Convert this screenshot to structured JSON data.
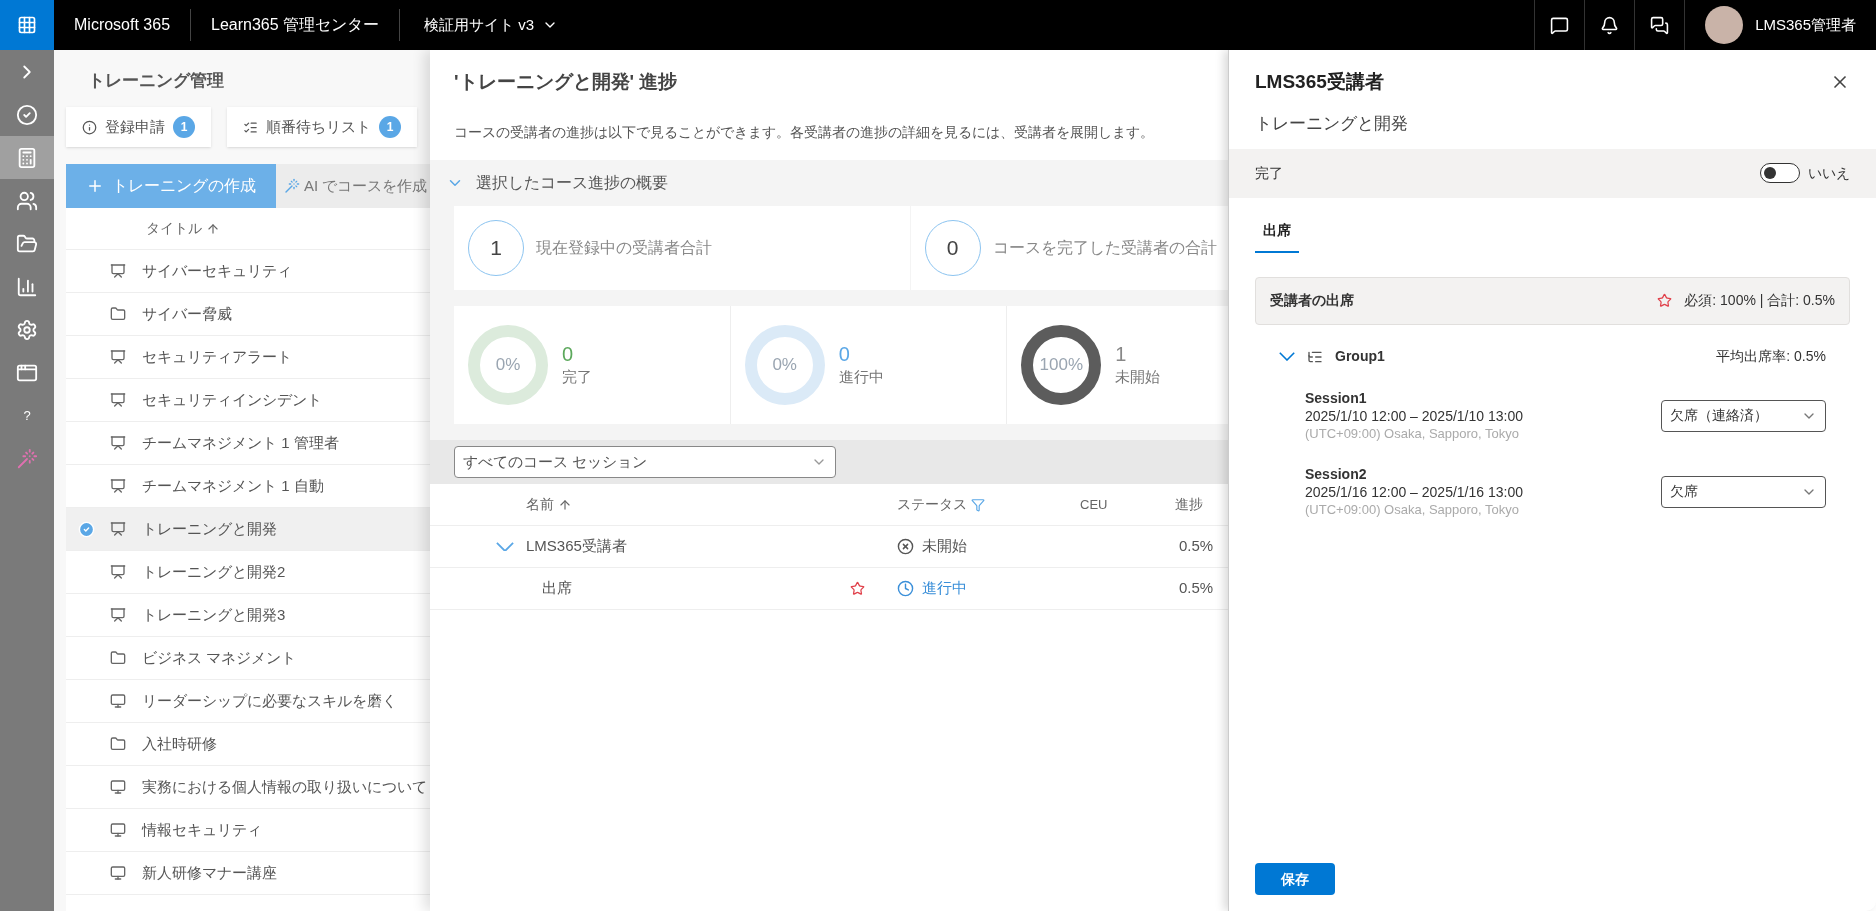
{
  "top_bar": {
    "app_name": "Microsoft 365",
    "product": "Learn365 管理センター",
    "site": "検証用サイト v3",
    "user": "LMS365管理者"
  },
  "rail": [
    {
      "kind": "expand",
      "selected": false
    },
    {
      "kind": "check",
      "selected": false
    },
    {
      "kind": "calculator",
      "selected": true
    },
    {
      "kind": "people",
      "selected": false
    },
    {
      "kind": "folder",
      "selected": false
    },
    {
      "kind": "chart",
      "selected": false
    },
    {
      "kind": "settings",
      "selected": false
    },
    {
      "kind": "app",
      "selected": false
    },
    {
      "kind": "help",
      "selected": false,
      "label": "?"
    },
    {
      "kind": "wand",
      "selected": false
    }
  ],
  "training": {
    "title": "トレーニング管理",
    "cards": [
      {
        "kind": "info",
        "label": "登録申請",
        "count": "1"
      },
      {
        "kind": "queue",
        "label": "順番待ちリスト",
        "count": "1"
      }
    ],
    "create_button": "トレーニングの作成",
    "ai_button": "AI でコースを作成",
    "column": "タイトル",
    "items": [
      {
        "kind": "course",
        "label": "サイバーセキュリティ",
        "selected": false
      },
      {
        "kind": "folder",
        "label": "サイバー脅威",
        "selected": false
      },
      {
        "kind": "course",
        "label": "セキュリティアラート",
        "selected": false
      },
      {
        "kind": "course",
        "label": "セキュリティインシデント",
        "selected": false
      },
      {
        "kind": "course",
        "label": "チームマネジメント 1 管理者",
        "selected": false
      },
      {
        "kind": "course",
        "label": "チームマネジメント 1 自動",
        "selected": false
      },
      {
        "kind": "course",
        "label": "トレーニングと開発",
        "selected": true
      },
      {
        "kind": "course",
        "label": "トレーニングと開発2",
        "selected": false
      },
      {
        "kind": "course",
        "label": "トレーニングと開発3",
        "selected": false
      },
      {
        "kind": "folder",
        "label": "ビジネス マネジメント",
        "selected": false
      },
      {
        "kind": "elearning",
        "label": "リーダーシップに必要なスキルを磨く",
        "selected": false
      },
      {
        "kind": "folder",
        "label": "入社時研修",
        "selected": false
      },
      {
        "kind": "elearning",
        "label": "実務における個人情報の取り扱いについて",
        "selected": false
      },
      {
        "kind": "elearning",
        "label": "情報セキュリティ",
        "selected": false
      },
      {
        "kind": "elearning",
        "label": "新人研修マナー講座",
        "selected": false
      }
    ]
  },
  "progress": {
    "title": "'トレーニングと開発' 進捗",
    "description": "コースの受講者の進捗は以下で見ることができます。各受講者の進捗の詳細を見るには、受講者を展開します。",
    "summary": {
      "label": "選択したコース進捗の概要",
      "expanded": true
    },
    "totals": [
      {
        "value": "1",
        "label": "現在登録中の受講者合計"
      },
      {
        "value": "0",
        "label": "コースを完了した受講者の合計"
      }
    ],
    "donuts": [
      {
        "kind": "completed",
        "percent": "0%",
        "value": "0",
        "label": "完了",
        "color": "#dcebdc"
      },
      {
        "kind": "in_progress",
        "percent": "0%",
        "value": "0",
        "label": "進行中",
        "color": "#dbeaf7"
      },
      {
        "kind": "not_started",
        "percent": "100%",
        "value": "1",
        "label": "未開始",
        "color": "#5c5c5c"
      }
    ],
    "session_filter": "すべてのコース セッション",
    "columns": [
      "名前",
      "ステータス",
      "CEU",
      "進捗"
    ],
    "rows": [
      {
        "name": "LMS365受講者",
        "expanded": true,
        "required": false,
        "status": {
          "kind": "not_started",
          "label": "未開始"
        },
        "progress": "0.5%"
      },
      {
        "name": "出席",
        "required": true,
        "status": {
          "kind": "in_progress",
          "label": "進行中"
        },
        "progress": "0.5%"
      }
    ]
  },
  "detail": {
    "title": "LMS365受講者",
    "subtitle": "トレーニングと開発",
    "complete": {
      "label": "完了",
      "on": false,
      "state": "いいえ"
    },
    "tabs": [
      {
        "label": "出席",
        "selected": true
      }
    ],
    "attendance": {
      "title": "受講者の出席",
      "summary": "必須: 100% | 合計: 0.5%"
    },
    "group": {
      "name": "Group1",
      "expanded": true,
      "average": "平均出席率: 0.5%",
      "sessions": [
        {
          "name": "Session1",
          "time": "2025/1/10 12:00 – 2025/1/10 13:00",
          "zone": "(UTC+09:00) Osaka, Sapporo, Tokyo",
          "status": "欠席（連絡済）"
        },
        {
          "name": "Session2",
          "time": "2025/1/16 12:00 – 2025/1/16 13:00",
          "zone": "(UTC+09:00) Osaka, Sapporo, Tokyo",
          "status": "欠席"
        }
      ]
    },
    "save_button": "保存"
  }
}
